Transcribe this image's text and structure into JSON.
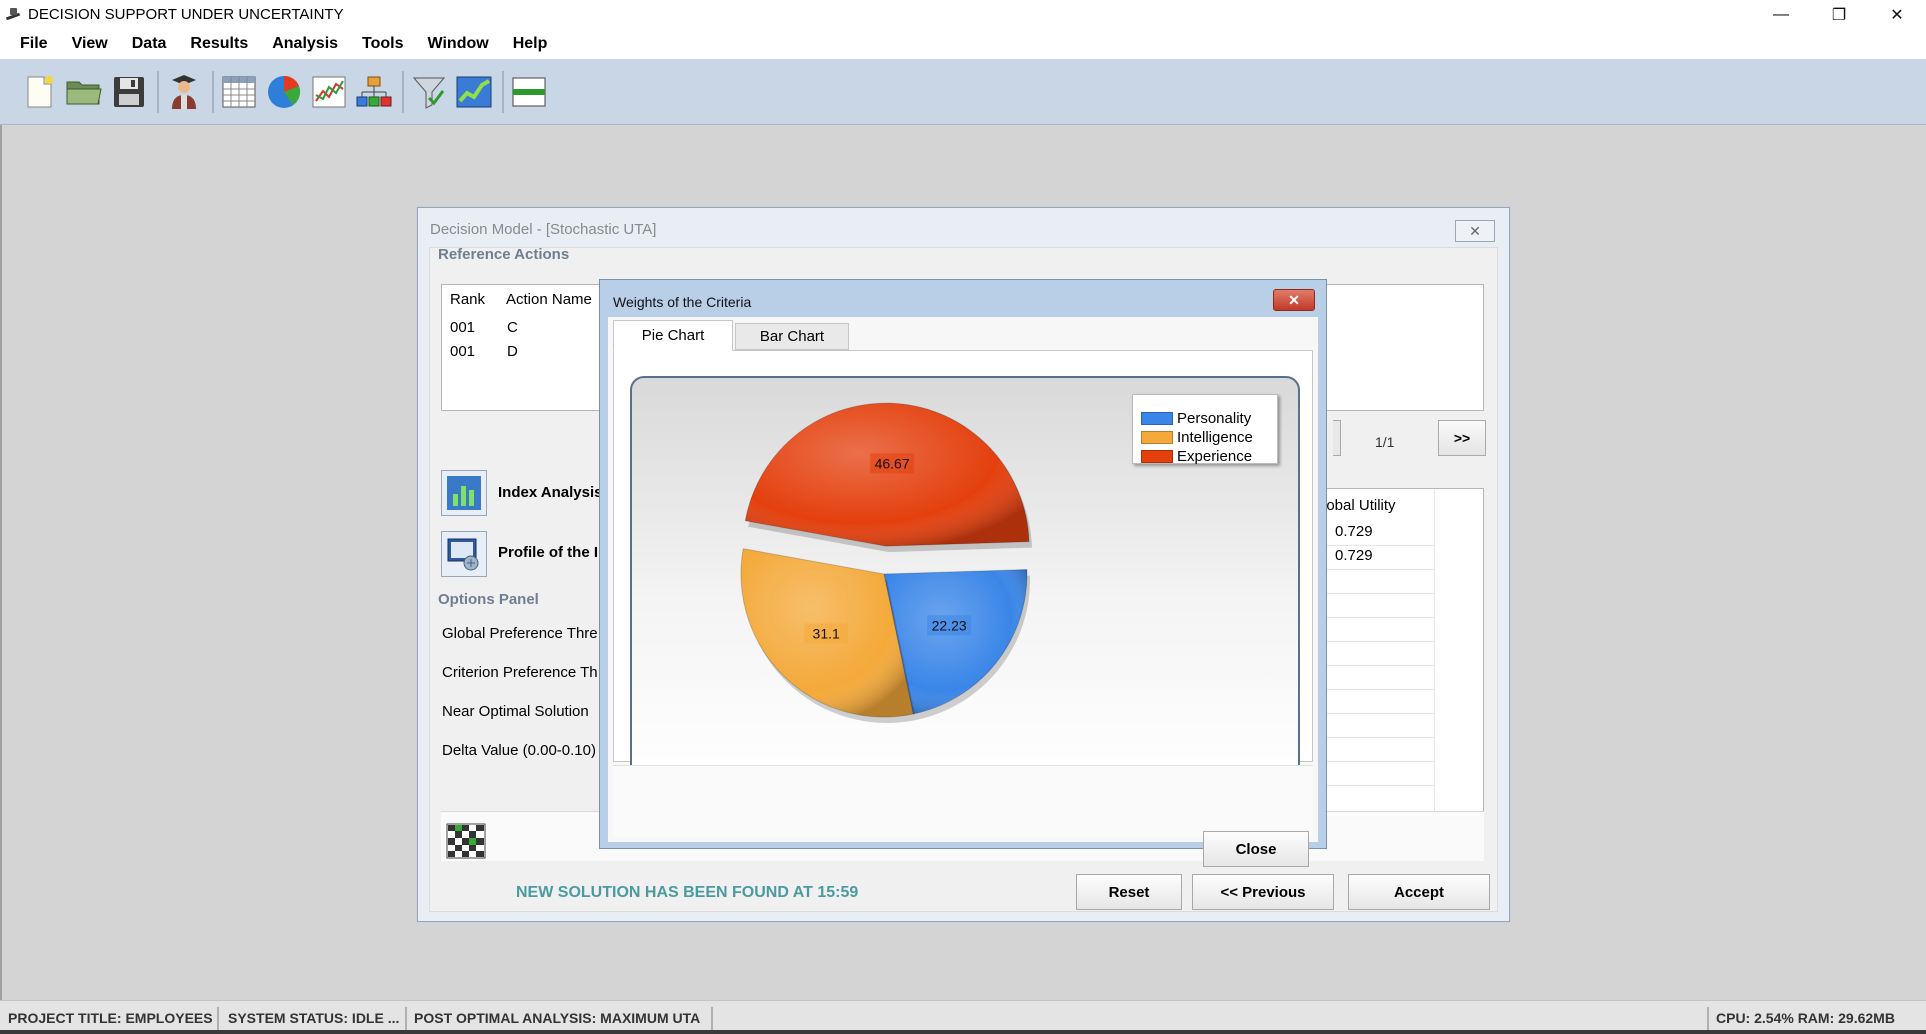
{
  "app": {
    "title": "DECISION SUPPORT UNDER UNCERTAINTY",
    "window_controls": [
      "minimize-icon",
      "restore-icon",
      "close-icon"
    ]
  },
  "menu": [
    "File",
    "View",
    "Data",
    "Results",
    "Analysis",
    "Tools",
    "Window",
    "Help"
  ],
  "toolbar": {
    "icons": [
      "new-document-icon",
      "open-folder-icon",
      "save-icon",
      "decision-maker-icon",
      "table-icon",
      "pie-chart-icon",
      "line-chart-icon",
      "hierarchy-icon",
      "filter-icon",
      "trend-chart-icon",
      "split-view-icon"
    ]
  },
  "model_window": {
    "title": "Decision Model - [Stochastic UTA]",
    "reference_actions_label": "Reference Actions",
    "table_headers": {
      "rank": "Rank",
      "action_name": "Action Name"
    },
    "rows": [
      {
        "rank": "001",
        "name": "C"
      },
      {
        "rank": "001",
        "name": "D"
      }
    ],
    "page_indicator": "1/1",
    "next_button": ">>",
    "index_analysis_label": "Index Analysis",
    "profile_label": "Profile of the I",
    "options_panel_label": "Options Panel",
    "options": [
      "Global Preference Thre",
      "Criterion Preference Th",
      "Near Optimal Solution",
      "Delta Value (0.00-0.10)"
    ],
    "global_utility_header": "lobal Utility",
    "global_utility_values": [
      "0.729",
      "0.729"
    ],
    "status_message": "NEW SOLUTION HAS BEEN FOUND AT 15:59",
    "buttons": {
      "reset": "Reset",
      "previous": "<< Previous",
      "accept": "Accept"
    }
  },
  "dialog": {
    "title": "Weights of the Criteria",
    "tabs": [
      "Pie Chart",
      "Bar Chart"
    ],
    "active_tab": "Pie Chart",
    "close_button": "Close"
  },
  "chart_data": {
    "type": "pie",
    "labels": [
      "Personality",
      "Intelligence",
      "Experience"
    ],
    "values": [
      22.23,
      31.1,
      46.67
    ],
    "colors": [
      "#3a86e8",
      "#f4a93a",
      "#e4400e"
    ],
    "legend_position": "top-right",
    "exploded": "Experience"
  },
  "statusbar": {
    "project": "PROJECT TITLE: EMPLOYEES",
    "system": "SYSTEM STATUS: IDLE ...",
    "analysis": "POST OPTIMAL ANALYSIS: MAXIMUM UTA",
    "resources": "CPU: 2.54% RAM: 29.62MB"
  }
}
